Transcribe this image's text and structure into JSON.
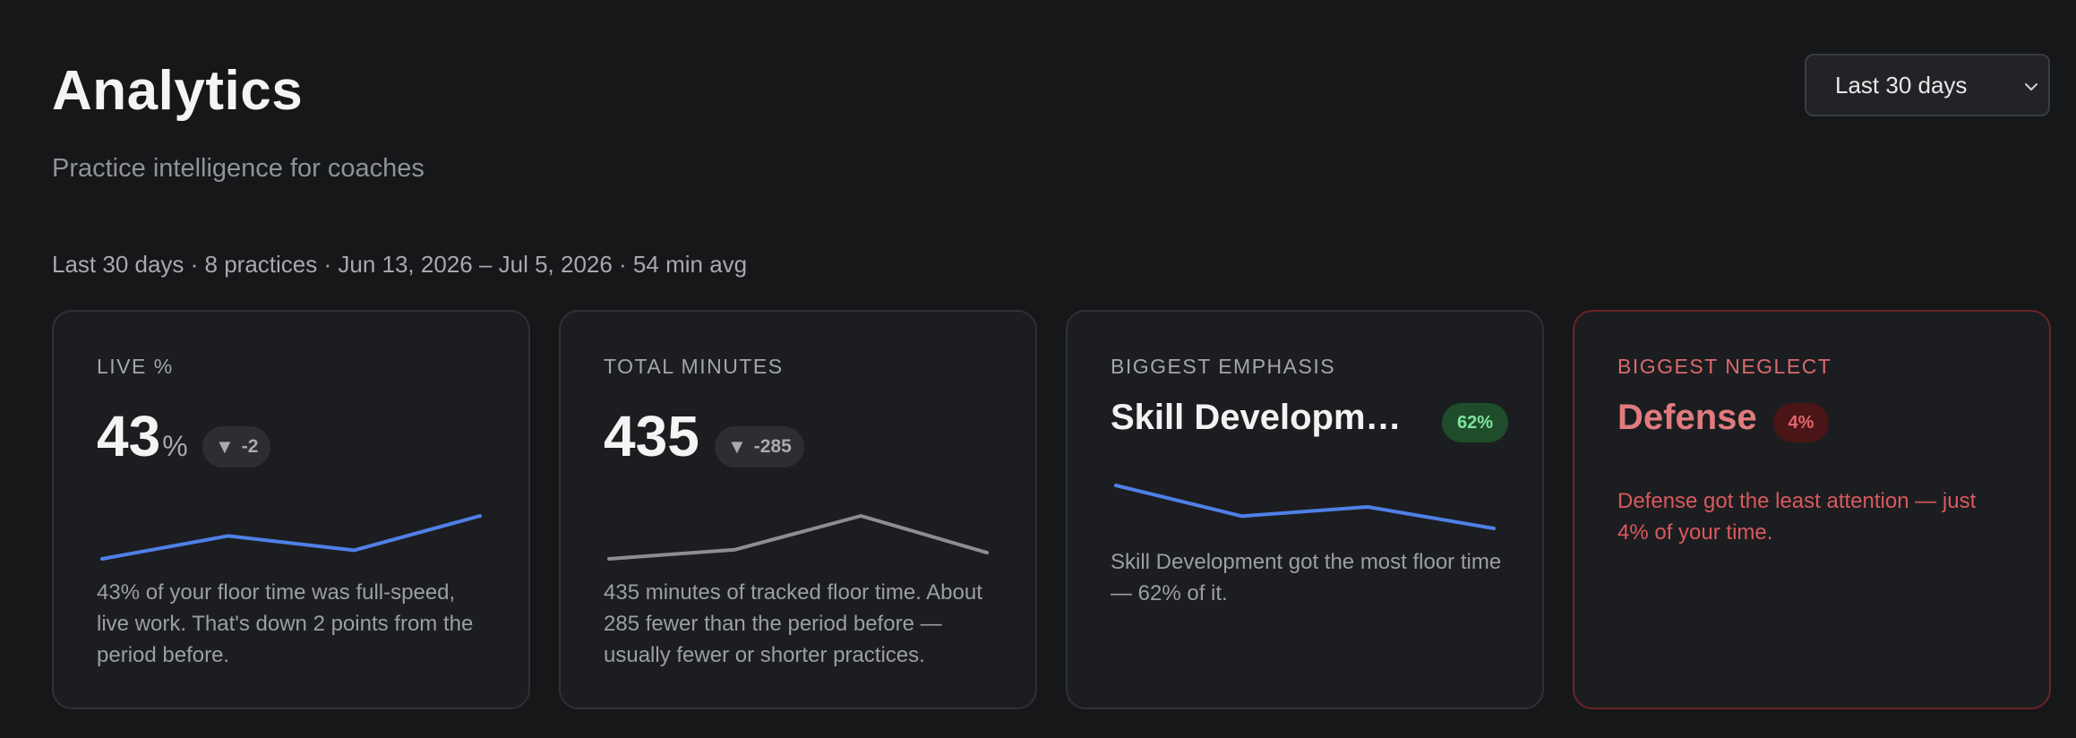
{
  "header": {
    "title": "Analytics",
    "subtitle": "Practice intelligence for coaches",
    "range_select": {
      "value": "Last 30 days",
      "icon": "chevron-down-icon"
    }
  },
  "summary": "Last 30 days · 8 practices · Jun 13, 2026 – Jul 5, 2026 · 54 min avg",
  "cards": {
    "live": {
      "label": "LIVE %",
      "value": "43",
      "unit": "%",
      "delta": "-2",
      "delta_icon": "down-triangle-icon",
      "spark_color": "#4f80e8",
      "spark": [
        2,
        10,
        5,
        17
      ],
      "description": "43% of your floor time was full-speed, live work. That's down 2 points from the period before."
    },
    "minutes": {
      "label": "TOTAL MINUTES",
      "value": "435",
      "delta": "-285",
      "delta_icon": "down-triangle-icon",
      "spark_color": "#8c8e92",
      "spark": [
        2,
        5,
        16,
        4
      ],
      "description": "435 minutes of tracked floor time. About 285 fewer than the period before — usually fewer or shorter practices."
    },
    "emphasis": {
      "label": "BIGGEST EMPHASIS",
      "name": "Skill Developm…",
      "pct": "62%",
      "spark_color": "#4f80e8",
      "spark": [
        16,
        6,
        9,
        2
      ],
      "description": "Skill Development got the most floor time — 62% of it."
    },
    "neglect": {
      "label": "BIGGEST NEGLECT",
      "name": "Defense",
      "pct": "4%",
      "description": "Defense got the least attention — just 4% of your time."
    }
  }
}
